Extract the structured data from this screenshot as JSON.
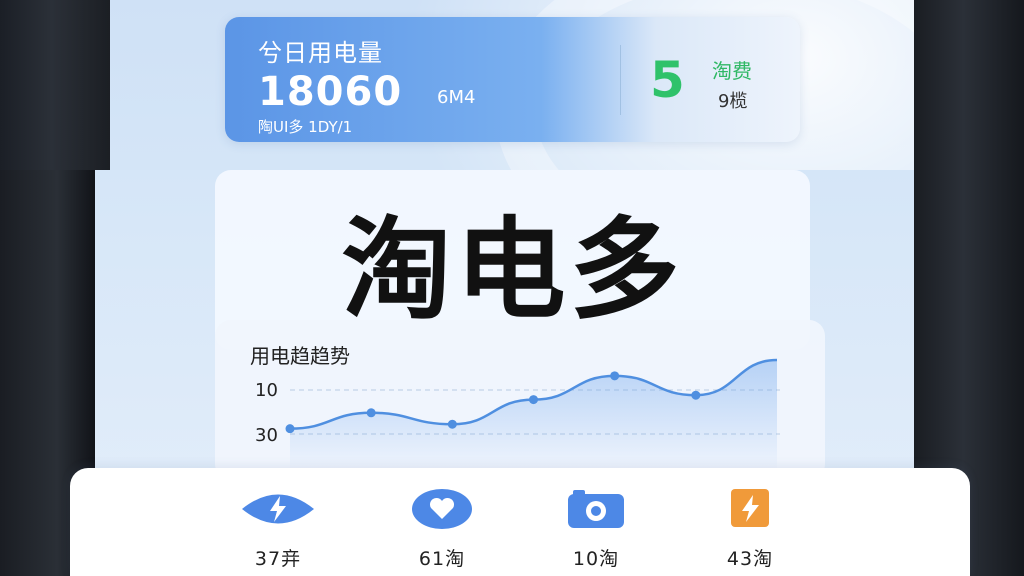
{
  "usage": {
    "title": "兮日用电量",
    "value": "18060",
    "unit": "6M4",
    "subtitle": "陶UI多 1DY/1"
  },
  "score": {
    "value": "5",
    "label": "淘费",
    "sub": "9榄"
  },
  "brand": {
    "title": "淘电多"
  },
  "chart_data": {
    "type": "line",
    "title": "用电趋趋势",
    "ytick_labels": [
      "10",
      "30"
    ],
    "series": [
      {
        "values": [
          22,
          40,
          27,
          55,
          82,
          60,
          100
        ]
      }
    ],
    "color": "#4f8fe0",
    "grid": true
  },
  "nav": {
    "items": [
      {
        "label": "37竎",
        "icon": "lightning-eye-icon",
        "color": "#4d88e6"
      },
      {
        "label": "61淘",
        "icon": "heart-icon",
        "color": "#4d88e6"
      },
      {
        "label": "10淘",
        "icon": "camera-icon",
        "color": "#4d88e6"
      },
      {
        "label": "43淘",
        "icon": "lightning-square-icon",
        "color": "#f09a3a"
      }
    ]
  }
}
